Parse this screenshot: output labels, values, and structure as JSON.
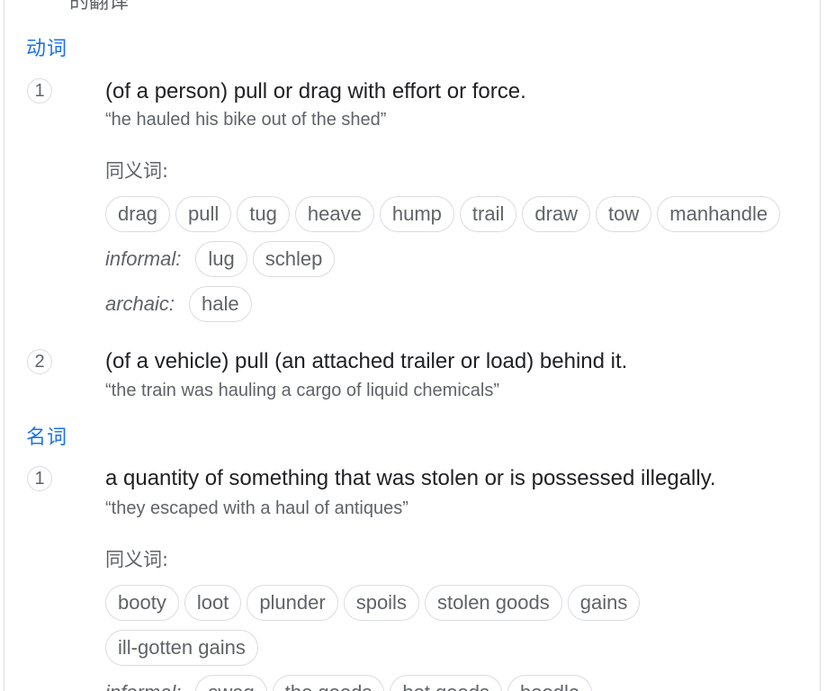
{
  "top_fragment": "的翻译",
  "verb": {
    "label": "动词",
    "senses": [
      {
        "number": "1",
        "definition": "(of a person) pull or drag with effort or force.",
        "example": "“he hauled his bike out of the shed”",
        "synonyms_heading": "同义词:",
        "synonyms": [
          "drag",
          "pull",
          "tug",
          "heave",
          "hump",
          "trail",
          "draw",
          "tow",
          "manhandle"
        ],
        "informal_label": "informal:",
        "informal": [
          "lug",
          "schlep"
        ],
        "archaic_label": "archaic:",
        "archaic": [
          "hale"
        ]
      },
      {
        "number": "2",
        "definition": "(of a vehicle) pull (an attached trailer or load) behind it.",
        "example": "“the train was hauling a cargo of liquid chemicals”"
      }
    ]
  },
  "noun": {
    "label": "名词",
    "senses": [
      {
        "number": "1",
        "definition": "a quantity of something that was stolen or is possessed illegally.",
        "example": "“they escaped with a haul of antiques”",
        "synonyms_heading": "同义词:",
        "synonyms": [
          "booty",
          "loot",
          "plunder",
          "spoils",
          "stolen goods",
          "gains",
          "ill-gotten gains"
        ],
        "informal_label": "informal:",
        "informal": [
          "swag",
          "the goods",
          "hot goods",
          "boodle"
        ]
      }
    ]
  },
  "colors": {
    "accent": "#1a73e8",
    "text": "#202124",
    "muted": "#5f6368",
    "border": "#dadce0"
  }
}
